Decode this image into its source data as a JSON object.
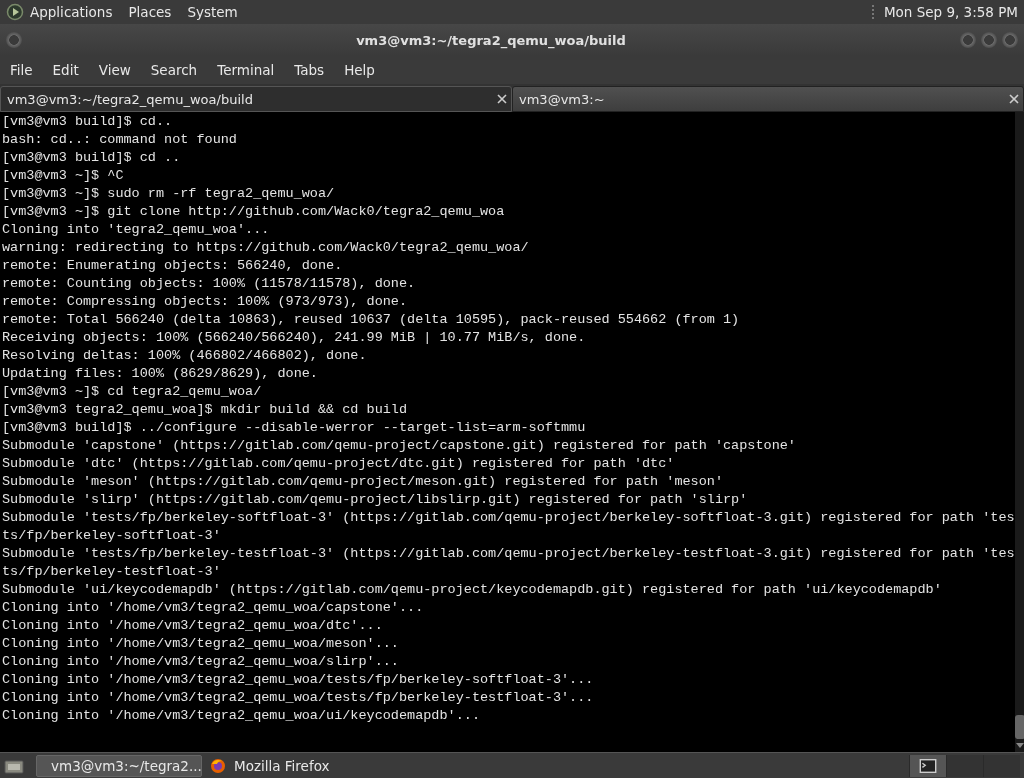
{
  "top_panel": {
    "menus": [
      "Applications",
      "Places",
      "System"
    ],
    "clock": "Mon Sep  9,  3:58 PM"
  },
  "window": {
    "title": "vm3@vm3:~/tegra2_qemu_woa/build"
  },
  "menu_bar": [
    "File",
    "Edit",
    "View",
    "Search",
    "Terminal",
    "Tabs",
    "Help"
  ],
  "tabs": [
    {
      "label": "vm3@vm3:~/tegra2_qemu_woa/build",
      "selected": true
    },
    {
      "label": "vm3@vm3:~",
      "selected": false
    }
  ],
  "terminal_lines": [
    "[vm3@vm3 build]$ cd..",
    "bash: cd..: command not found",
    "[vm3@vm3 build]$ cd ..",
    "[vm3@vm3 ~]$ ^C",
    "[vm3@vm3 ~]$ sudo rm -rf tegra2_qemu_woa/",
    "[vm3@vm3 ~]$ git clone http://github.com/Wack0/tegra2_qemu_woa",
    "Cloning into 'tegra2_qemu_woa'...",
    "warning: redirecting to https://github.com/Wack0/tegra2_qemu_woa/",
    "remote: Enumerating objects: 566240, done.",
    "remote: Counting objects: 100% (11578/11578), done.",
    "remote: Compressing objects: 100% (973/973), done.",
    "remote: Total 566240 (delta 10863), reused 10637 (delta 10595), pack-reused 554662 (from 1)",
    "Receiving objects: 100% (566240/566240), 241.99 MiB | 10.77 MiB/s, done.",
    "Resolving deltas: 100% (466802/466802), done.",
    "Updating files: 100% (8629/8629), done.",
    "[vm3@vm3 ~]$ cd tegra2_qemu_woa/",
    "[vm3@vm3 tegra2_qemu_woa]$ mkdir build && cd build",
    "[vm3@vm3 build]$ ../configure --disable-werror --target-list=arm-softmmu",
    "Submodule 'capstone' (https://gitlab.com/qemu-project/capstone.git) registered for path 'capstone'",
    "Submodule 'dtc' (https://gitlab.com/qemu-project/dtc.git) registered for path 'dtc'",
    "Submodule 'meson' (https://gitlab.com/qemu-project/meson.git) registered for path 'meson'",
    "Submodule 'slirp' (https://gitlab.com/qemu-project/libslirp.git) registered for path 'slirp'",
    "Submodule 'tests/fp/berkeley-softfloat-3' (https://gitlab.com/qemu-project/berkeley-softfloat-3.git) registered for path 'tes",
    "ts/fp/berkeley-softfloat-3'",
    "Submodule 'tests/fp/berkeley-testfloat-3' (https://gitlab.com/qemu-project/berkeley-testfloat-3.git) registered for path 'tes",
    "ts/fp/berkeley-testfloat-3'",
    "Submodule 'ui/keycodemapdb' (https://gitlab.com/qemu-project/keycodemapdb.git) registered for path 'ui/keycodemapdb'",
    "Cloning into '/home/vm3/tegra2_qemu_woa/capstone'...",
    "Cloning into '/home/vm3/tegra2_qemu_woa/dtc'...",
    "Cloning into '/home/vm3/tegra2_qemu_woa/meson'...",
    "Cloning into '/home/vm3/tegra2_qemu_woa/slirp'...",
    "Cloning into '/home/vm3/tegra2_qemu_woa/tests/fp/berkeley-softfloat-3'...",
    "Cloning into '/home/vm3/tegra2_qemu_woa/tests/fp/berkeley-testfloat-3'...",
    "Cloning into '/home/vm3/tegra2_qemu_woa/ui/keycodemapdb'..."
  ],
  "taskbar": [
    {
      "label": "vm3@vm3:~/tegra2...",
      "kind": "terminal",
      "selected": true
    },
    {
      "label": "Mozilla Firefox",
      "kind": "browser",
      "selected": false
    }
  ]
}
